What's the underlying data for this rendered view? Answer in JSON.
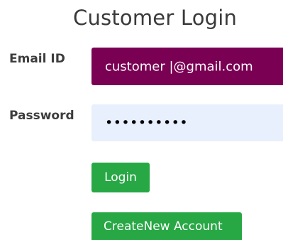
{
  "title": "Customer Login",
  "form": {
    "email_label": "Email ID",
    "email_value": "customer |@gmail.com",
    "password_label": "Password",
    "password_value": "••••••••••"
  },
  "buttons": {
    "login": "Login",
    "create_account": "CreateNew Account"
  },
  "colors": {
    "email_field_bg": "#7a0053",
    "password_field_bg": "#e8f0fe",
    "button_bg": "#28a745",
    "title_text": "#3a3a3a",
    "label_text": "#3d3d3d"
  }
}
